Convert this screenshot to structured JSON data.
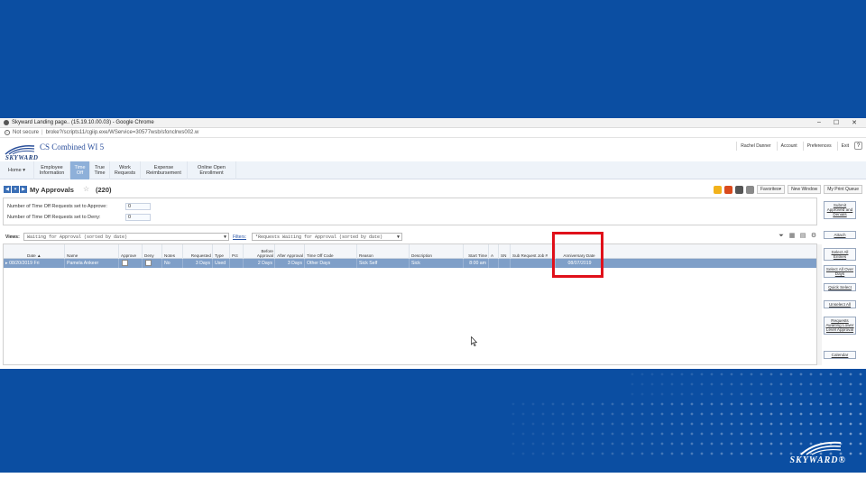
{
  "browser": {
    "title": "Skyward Landing page.. (15.19.10.00.03) - Google Chrome",
    "not_secure": "Not secure",
    "url": "broke?/scripts11/cgiip.exe/WService=30577wsb/sfonclrws002.w",
    "minimize": "–",
    "restore": "☐",
    "close": "✕"
  },
  "app": {
    "logo_text": "SKYWARD",
    "product_name": "CS Combined WI 5",
    "top_links": [
      "Rachel Danner",
      "Account",
      "Preferences",
      "Exit"
    ],
    "help": "?"
  },
  "menu": [
    {
      "label": "Home ▾",
      "active": false
    },
    {
      "label": "Employee Information",
      "active": false
    },
    {
      "label": "Time Off",
      "active": true
    },
    {
      "label": "True Time",
      "active": false
    },
    {
      "label": "Work Requests",
      "active": false
    },
    {
      "label": "Expense Reimbursement",
      "active": false
    },
    {
      "label": "Online Open Enrollment",
      "active": false
    }
  ],
  "page": {
    "title": "My Approvals",
    "count": "(220)",
    "tools": [
      "Favorites▾",
      "New Window",
      "My Print Queue"
    ]
  },
  "counts": {
    "approve_label": "Number of Time Off Requests set to Approve:",
    "approve_value": "0",
    "deny_label": "Number of Time Off Requests set to Deny:",
    "deny_value": "0"
  },
  "views": {
    "label": "Views:",
    "selected": "Waiting for Approval (sorted by date)",
    "filters_label": "Filters:",
    "filter_selected": "*Requests Waiting for Approval (sorted by date)"
  },
  "grid": {
    "columns": [
      "Date ▲",
      "Name",
      "Approve",
      "Deny",
      "Notes",
      "Requested",
      "Type",
      "Pct",
      "Before Approval",
      "After Approval",
      "Time Off Code",
      "Reason",
      "Description",
      "Start Time",
      "A",
      "SN",
      "Sub Request Job #",
      "Anniversary Date"
    ],
    "rows": [
      {
        "expand": "▸",
        "date": "08/20/2019 Fri",
        "name": "Pamela Ankeer",
        "notes": "No",
        "requested": "3 Days",
        "type": "Used",
        "before": "2 Days",
        "after": "3 Days",
        "time_off_code": "Other Days",
        "reason": "Sick Self",
        "description": "Sick",
        "start_time": "8:00 am",
        "anniversary": "08/07/2019"
      }
    ]
  },
  "side_buttons": [
    "Submit Approved and Denials",
    "Attach",
    "Select All Entries",
    "Select All Over Days",
    "Quick Select",
    "Unselect All",
    "Requests Awaiting Lower Level Approval",
    "Calendar"
  ],
  "footer": {
    "logo_text": "SKYWARD®"
  }
}
